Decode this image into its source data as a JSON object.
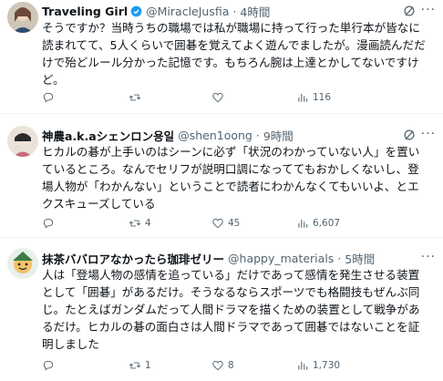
{
  "tweets": [
    {
      "name": "Traveling Girl",
      "handle": "@MiracleJusfia",
      "sep": "·",
      "time": "4時間",
      "text": "そうですか？当時うちの職場では私が職場に持って行った単行本が皆なに読まれてて、5人くらいで囲碁を覚えてよく遊んでましたが。漫画読んだだけで殆どルール分かった記憶です。もちろん腕は上達とかしてないですけど。",
      "replies": "",
      "retweets": "",
      "likes": "",
      "views": "116"
    },
    {
      "name": "神農a.k.aシェンロン용일",
      "handle": "@shen1oong",
      "sep": "·",
      "time": "9時間",
      "text": "ヒカルの碁が上手いのはシーンに必ず「状況のわかっていない人」を置いているところ。なんでセリフが説明口調になっててもおかしくないし、登場人物が「わかんない」ということで読者にわかんなくてもいいよ、とエクスキューズしている",
      "replies": "",
      "retweets": "4",
      "likes": "45",
      "views": "6,607"
    },
    {
      "name": "抹茶ババロアなかったら珈琲ゼリー",
      "handle": "@happy_materials",
      "sep": "·",
      "time": "5時間",
      "text": "人は「登場人物の感情を追っている」だけであって感情を発生させる装置として「囲碁」があるだけ。そうなるならスポーツでも格闘技もぜんぶ同じ。たとえばガンダムだって人間ドラマを描くための装置として戦争があるだけ。ヒカルの碁の面白さは人間ドラマであって囲碁ではないことを証明しました",
      "replies": "",
      "retweets": "1",
      "likes": "8",
      "views": "1,730"
    }
  ],
  "icons": {
    "reply": "reply-icon",
    "retweet": "retweet-icon",
    "like": "heart-icon",
    "views": "views-icon",
    "grok": "grok-icon",
    "more": "more-icon",
    "verified": "verified-badge-icon"
  },
  "colors": {
    "text": "#0f1419",
    "secondary": "#536471",
    "verified": "#1d9bf0",
    "divider": "#eff3f4"
  }
}
